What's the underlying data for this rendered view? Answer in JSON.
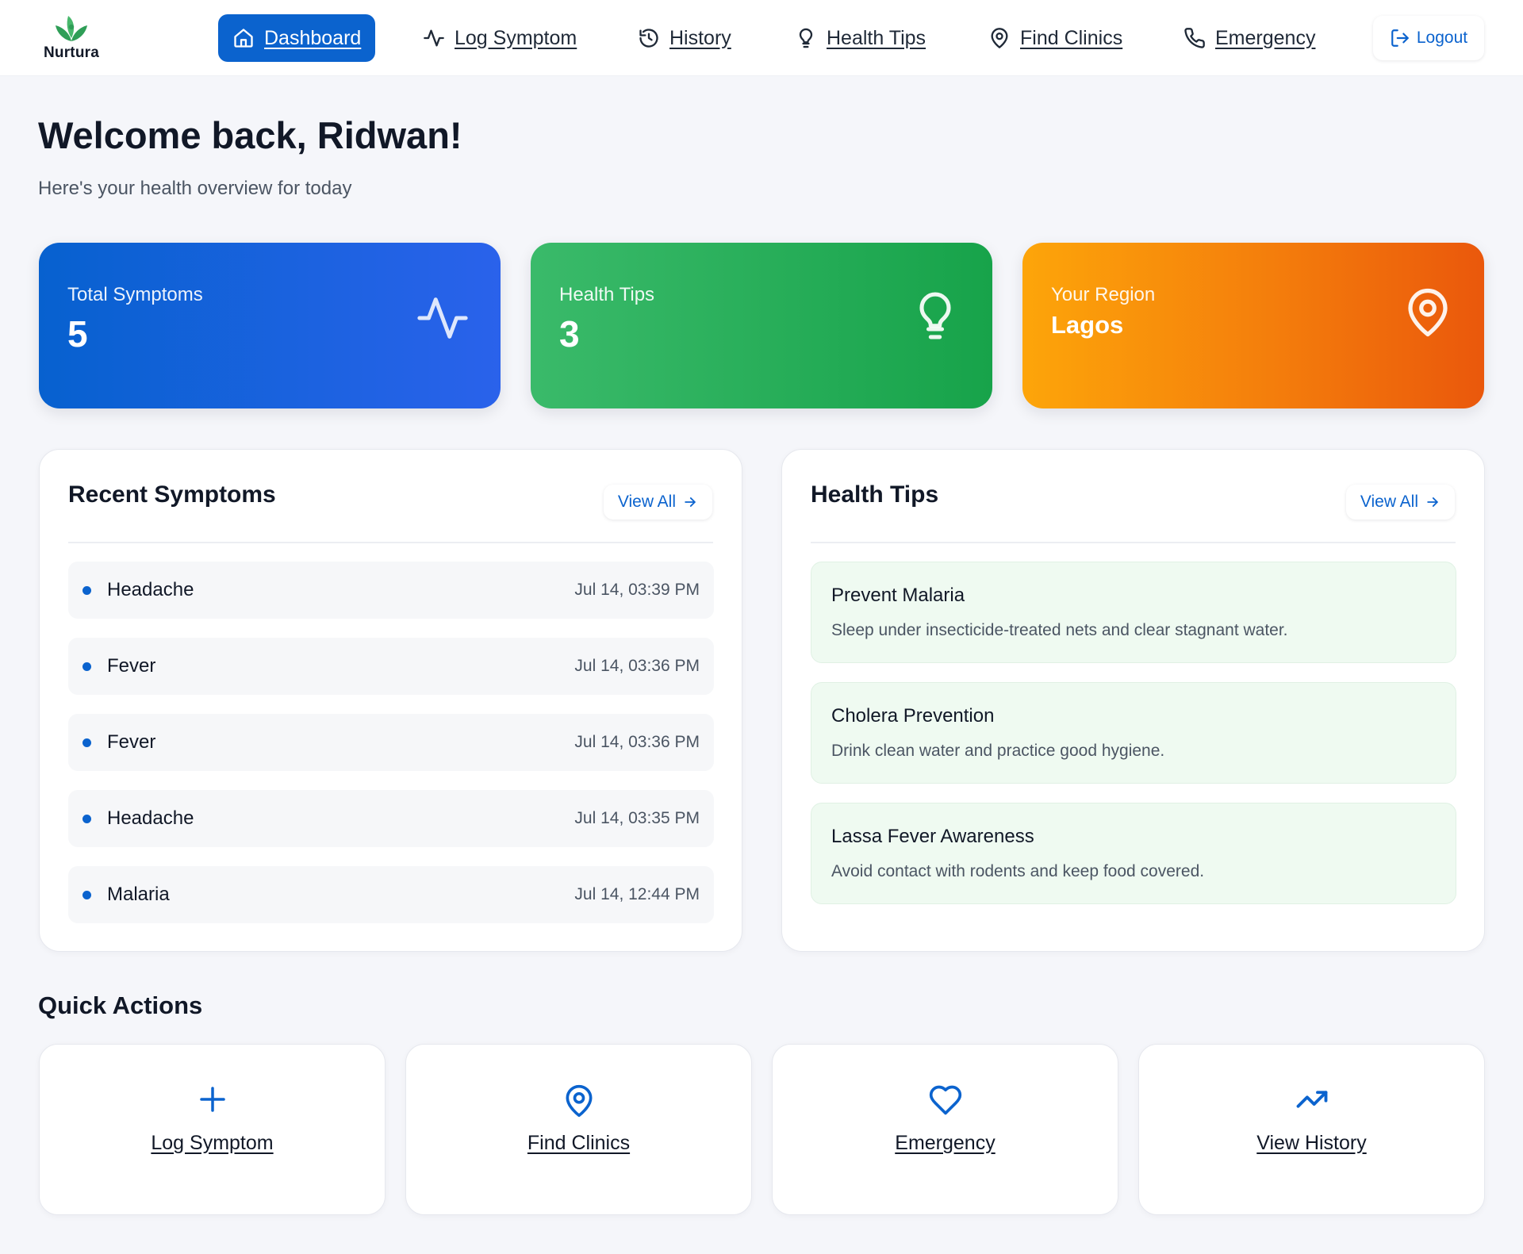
{
  "brand": {
    "name": "Nurtura",
    "accent": "#0b63ce"
  },
  "nav": {
    "items": [
      {
        "label": "Dashboard",
        "icon": "home-icon",
        "active": true
      },
      {
        "label": "Log Symptom",
        "icon": "activity-icon"
      },
      {
        "label": "History",
        "icon": "history-icon"
      },
      {
        "label": "Health Tips",
        "icon": "lightbulb-icon"
      },
      {
        "label": "Find Clinics",
        "icon": "map-pin-icon"
      },
      {
        "label": "Emergency",
        "icon": "phone-icon"
      }
    ],
    "logout_label": "Logout"
  },
  "header": {
    "welcome": "Welcome back, Ridwan!",
    "subtitle": "Here's your health overview for today"
  },
  "stats": [
    {
      "label": "Total Symptoms",
      "value": "5",
      "icon": "activity-icon",
      "color": "#0b63ce"
    },
    {
      "label": "Health Tips",
      "value": "3",
      "icon": "lightbulb-icon",
      "color": "#16a34a"
    },
    {
      "label": "Your Region",
      "value": "Lagos",
      "icon": "map-pin-icon",
      "color": "#f97316"
    }
  ],
  "recent_symptoms": {
    "title": "Recent Symptoms",
    "view_all": "View All",
    "items": [
      {
        "name": "Headache",
        "time": "Jul 14, 03:39 PM"
      },
      {
        "name": "Fever",
        "time": "Jul 14, 03:36 PM"
      },
      {
        "name": "Fever",
        "time": "Jul 14, 03:36 PM"
      },
      {
        "name": "Headache",
        "time": "Jul 14, 03:35 PM"
      },
      {
        "name": "Malaria",
        "time": "Jul 14, 12:44 PM"
      }
    ]
  },
  "health_tips": {
    "title": "Health Tips",
    "view_all": "View All",
    "items": [
      {
        "title": "Prevent Malaria",
        "desc": "Sleep under insecticide-treated nets and clear stagnant water."
      },
      {
        "title": "Cholera Prevention",
        "desc": "Drink clean water and practice good hygiene."
      },
      {
        "title": "Lassa Fever Awareness",
        "desc": "Avoid contact with rodents and keep food covered."
      }
    ]
  },
  "quick_actions": {
    "title": "Quick Actions",
    "items": [
      {
        "label": "Log Symptom",
        "icon": "plus-icon"
      },
      {
        "label": "Find Clinics",
        "icon": "map-pin-icon"
      },
      {
        "label": "Emergency",
        "icon": "heart-icon"
      },
      {
        "label": "View History",
        "icon": "trending-up-icon"
      }
    ]
  }
}
